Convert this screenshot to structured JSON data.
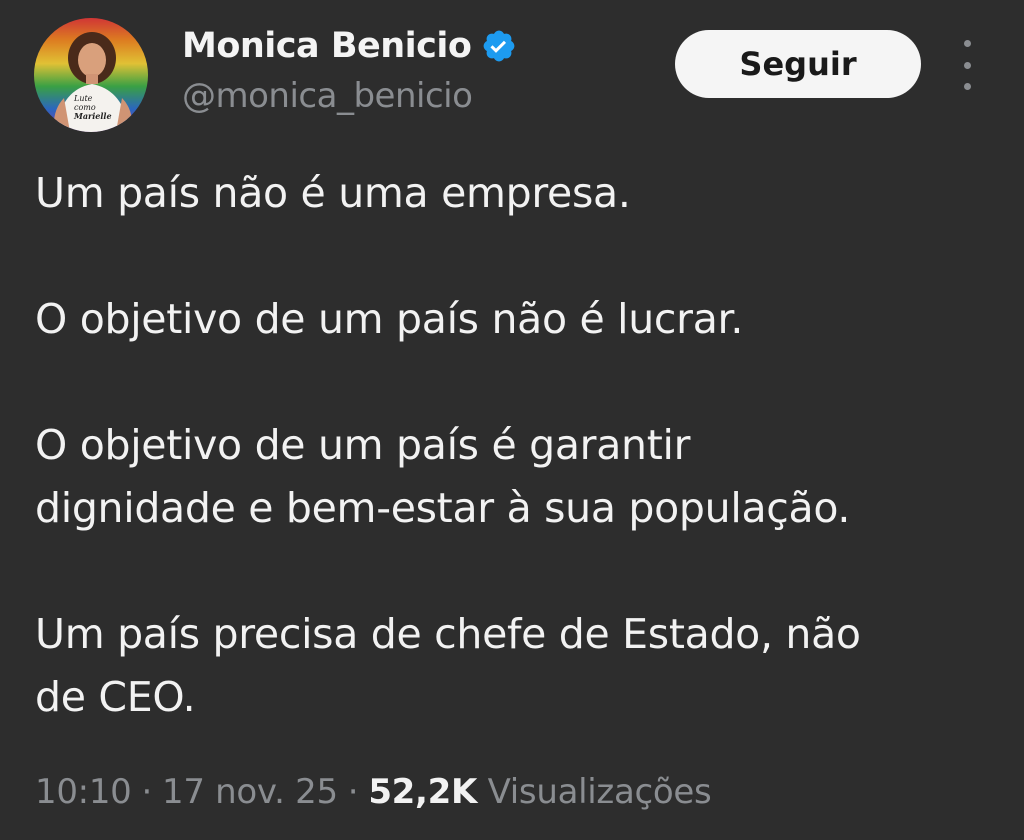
{
  "author": {
    "display_name": "Monica Benicio",
    "handle": "@monica_benicio",
    "verified_color": "#1d9bf0",
    "avatar_shirt_text": [
      "Lute",
      "como",
      "Marielle"
    ]
  },
  "actions": {
    "follow_label": "Seguir",
    "more_icon": "more-vertical-icon"
  },
  "tweet": {
    "paragraphs": [
      [
        "Um país não é uma empresa."
      ],
      [
        "O objetivo de um país não é lucrar."
      ],
      [
        "O objetivo de um país é garantir",
        "dignidade e bem-estar à sua população."
      ],
      [
        "Um país precisa de chefe de Estado, não",
        "de CEO."
      ]
    ]
  },
  "meta": {
    "time": "10:10",
    "separator": "·",
    "date": "17 nov. 25",
    "views_count": "52,2K",
    "views_label": "Visualizações"
  },
  "colors": {
    "background": "#2d2d2d",
    "text": "#f2f2f2",
    "secondary": "#8a8d91",
    "button_bg": "#f5f5f5",
    "button_text": "#1a1a1a"
  }
}
